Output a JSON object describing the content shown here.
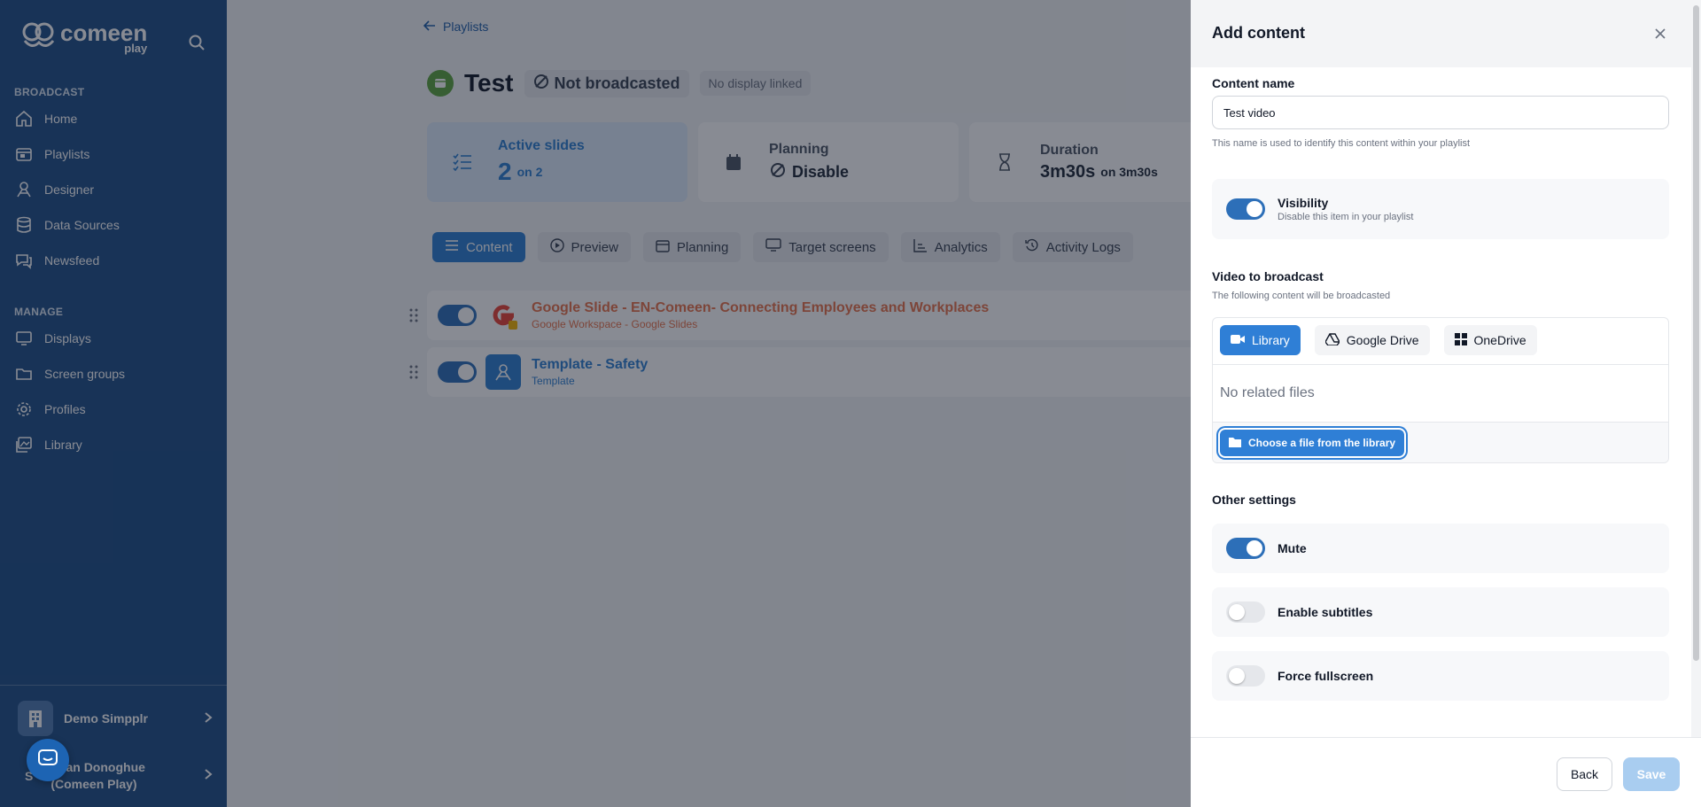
{
  "sidebar": {
    "logo_text": "comeen",
    "logo_sub": "play",
    "sections": {
      "broadcast": "BROADCAST",
      "manage": "MANAGE"
    },
    "broadcast_items": [
      {
        "label": "Home",
        "icon": "home-icon"
      },
      {
        "label": "Playlists",
        "icon": "playlist-icon"
      },
      {
        "label": "Designer",
        "icon": "designer-icon"
      },
      {
        "label": "Data Sources",
        "icon": "database-icon"
      },
      {
        "label": "Newsfeed",
        "icon": "newsfeed-icon"
      }
    ],
    "manage_items": [
      {
        "label": "Displays",
        "icon": "monitor-icon"
      },
      {
        "label": "Screen groups",
        "icon": "folder-icon"
      },
      {
        "label": "Profiles",
        "icon": "gear-icon"
      },
      {
        "label": "Library",
        "icon": "library-icon"
      }
    ],
    "org_name": "Demo Simpplr",
    "user_initial": "S",
    "user_name_line1": "Sean Donoghue",
    "user_name_line2": "(Comeen Play)"
  },
  "main": {
    "back_label": "Playlists",
    "playlist_title": "Test",
    "status_badge": "Not broadcasted",
    "display_badge": "No display linked",
    "stats": {
      "active": {
        "label": "Active slides",
        "value": "2",
        "suffix": "on 2"
      },
      "planning": {
        "label": "Planning",
        "value": "Disable"
      },
      "duration": {
        "label": "Duration",
        "value": "3m30s",
        "suffix": "on 3m30s"
      }
    },
    "tabs": [
      "Content",
      "Preview",
      "Planning",
      "Target screens",
      "Analytics",
      "Activity Logs"
    ],
    "rows": [
      {
        "title": "Google Slide - EN-Comeen- Connecting Employees and Workplaces",
        "subtitle": "Google Workspace - Google Slides",
        "title_color": "#e8734a"
      },
      {
        "title": "Template - Safety",
        "subtitle": "Template",
        "title_color": "#2c7fd1"
      }
    ]
  },
  "panel": {
    "title": "Add content",
    "content_name_label": "Content name",
    "content_name_value": "Test video",
    "content_name_help": "This name is used to identify this content within your playlist",
    "visibility_title": "Visibility",
    "visibility_sub": "Disable this item in your playlist",
    "video_label": "Video to broadcast",
    "video_help": "The following content will be broadcasted",
    "source_tabs": [
      "Library",
      "Google Drive",
      "OneDrive"
    ],
    "no_files": "No related files",
    "choose_file": "Choose a file from the library",
    "other_settings": "Other settings",
    "mute": "Mute",
    "subtitles": "Enable subtitles",
    "fullscreen": "Force fullscreen",
    "back_button": "Back",
    "save_button": "Save"
  },
  "colors": {
    "accent": "#2f7fd6",
    "sidebar": "#1e4f87",
    "overlay": "rgba(17,24,39,0.5)"
  }
}
